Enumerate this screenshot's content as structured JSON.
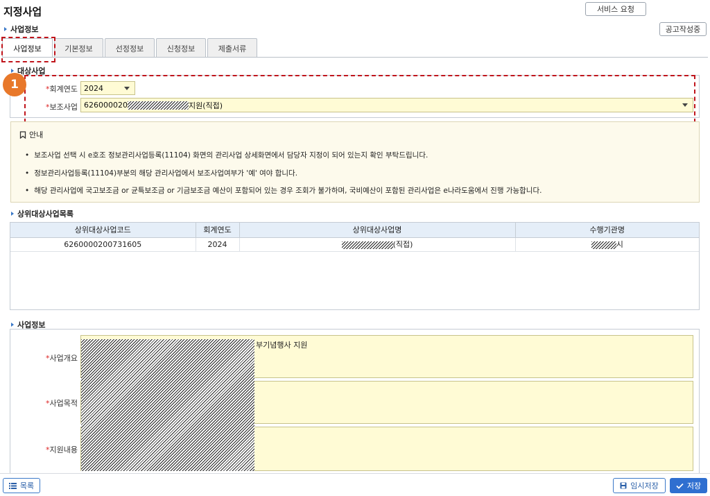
{
  "page": {
    "title": "지정사업"
  },
  "header": {
    "service_request_btn": "서비스 요청",
    "status_btn": "공고작성중"
  },
  "section_business_info": "사업정보",
  "tabs": [
    {
      "label": "사업정보"
    },
    {
      "label": "기본정보"
    },
    {
      "label": "선정정보"
    },
    {
      "label": "신청정보"
    },
    {
      "label": "제출서류"
    }
  ],
  "target": {
    "title": "대상사업",
    "fiscal_year_label": "회계연도",
    "fiscal_year_value": "2024",
    "subsidy_label": "보조사업",
    "subsidy_value_prefix": "626000020",
    "subsidy_value_suffix": "지원(직접)"
  },
  "annotation_badge": "1",
  "notice": {
    "head": "안내",
    "items": [
      "보조사업 선택 시 e호조 정보관리사업등록(11104) 화면의 관리사업 상세화면에서 담당자 지정이 되어 있는지 확인 부탁드립니다.",
      "정보관리사업등록(11104)부분의 해당 관리사업에서 보조사업여부가 '예' 여야 합니다.",
      "해당 관리사업에 국고보조금 or 균특보조금 or 기금보조금 예산이 포함되어 있는 경우 조회가 불가하며, 국비예산이 포함된 관리사업은 e나라도움에서 진행 가능합니다."
    ]
  },
  "parent_list": {
    "title": "상위대상사업목록",
    "columns": [
      "상위대상사업코드",
      "회계연도",
      "상위대상사업명",
      "수행기관명"
    ],
    "rows": [
      {
        "code": "6260000200731605",
        "year": "2024",
        "name_suffix": "(직접)",
        "org_suffix": "시"
      }
    ]
  },
  "business_info": {
    "title": "사업정보",
    "overview_label": "사업개요",
    "overview_text_suffix": "부기념행사 지원",
    "purpose_label": "사업목적",
    "support_label": "지원내용"
  },
  "footer": {
    "list_btn": "목록",
    "temp_save_btn": "임시저장",
    "save_btn": "저장"
  }
}
